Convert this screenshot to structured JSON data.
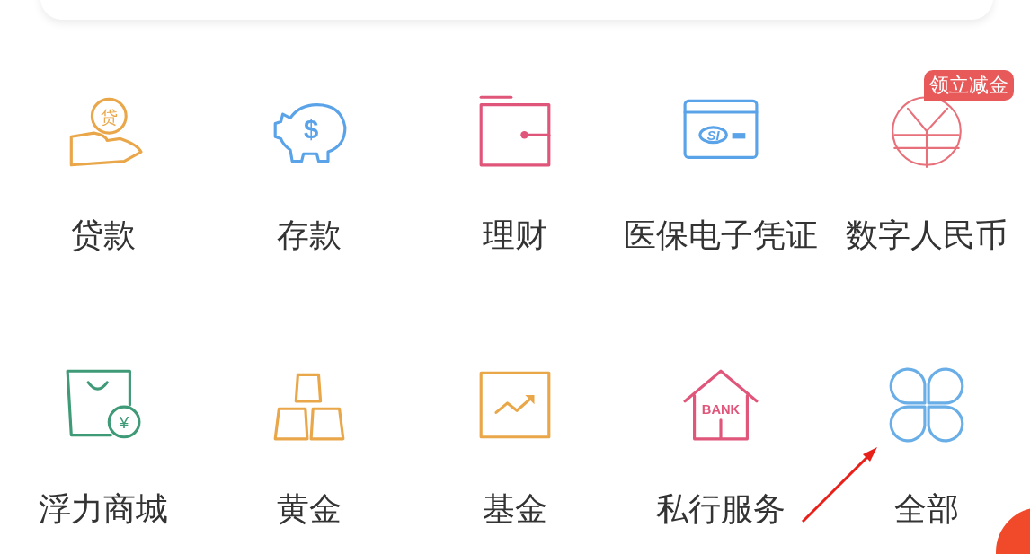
{
  "services": [
    {
      "kind": "loan",
      "icon_label": "贷",
      "label": "贷款"
    },
    {
      "kind": "piggy",
      "icon_label": "$",
      "label": "存款"
    },
    {
      "kind": "wallet",
      "label": "理财"
    },
    {
      "kind": "card",
      "icon_label": "SI",
      "label": "医保电子凭证"
    },
    {
      "kind": "yuan",
      "badge": "领立减金",
      "label": "数字人民币"
    },
    {
      "kind": "bag",
      "icon_label": "¥",
      "label": "浮力商城"
    },
    {
      "kind": "gold",
      "label": "黄金"
    },
    {
      "kind": "chart",
      "label": "基金"
    },
    {
      "kind": "bank",
      "icon_label": "BANK",
      "label": "私行服务"
    },
    {
      "kind": "clover",
      "label": "全部"
    }
  ]
}
